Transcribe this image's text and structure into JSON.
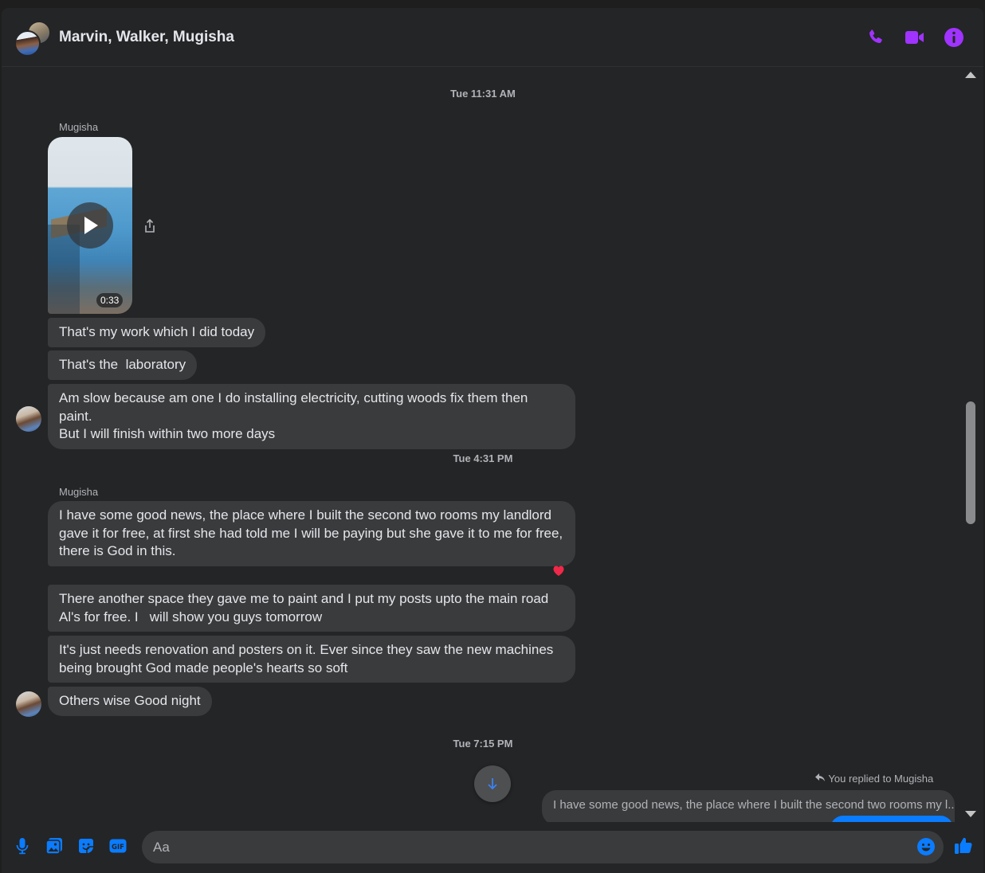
{
  "header": {
    "title": "Marvin, Walker, Mugisha",
    "accent_color": "#a033ff",
    "icons": [
      "phone-icon",
      "video-camera-icon",
      "info-icon"
    ]
  },
  "timestamps": [
    "Tue 11:31 AM",
    "Tue 4:31 PM",
    "Tue 7:15 PM"
  ],
  "senders": [
    "Mugisha",
    "Mugisha"
  ],
  "video": {
    "duration": "0:33"
  },
  "messages_group1": [
    "That's my work which I did today",
    "That's the  laboratory",
    "Am slow because am one I do installing electricity, cutting woods fix them then paint.\nBut I will finish within two more days"
  ],
  "messages_group2": [
    "I have some good news, the place where I built the second two rooms my landlord\ngave it for free, at first she had told me I will be paying but she gave it to me for free,\nthere is God in this.",
    "There another space they gave me to paint and I put my posts upto the main road\nAl's for free. I   will show you guys tomorrow",
    "It's just needs renovation and posters on it. Ever since they saw the new machines\nbeing brought God made people's hearts so soft",
    "Others wise Good night"
  ],
  "reaction": "heart-reaction",
  "reply": {
    "note": "You replied to Mugisha",
    "quoted": "I have some good news, the place where I built the second two rooms my l..."
  },
  "composer": {
    "placeholder": "Aa",
    "icons": [
      "microphone-icon",
      "photo-icon",
      "sticker-icon",
      "gif-icon",
      "emoji-icon",
      "thumbs-up-icon"
    ],
    "accent_color": "#0a7cff"
  }
}
